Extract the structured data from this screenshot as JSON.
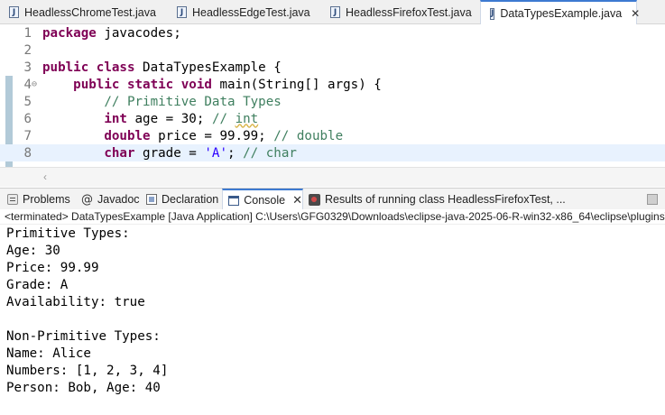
{
  "editor_tabs": [
    {
      "label": "HeadlessChromeTest.java",
      "active": false
    },
    {
      "label": "HeadlessEdgeTest.java",
      "active": false
    },
    {
      "label": "HeadlessFirefoxTest.java",
      "active": false
    },
    {
      "label": "DataTypesExample.java",
      "active": true
    }
  ],
  "editor_close_glyph": "✕",
  "file_icon_letter": "J",
  "code": {
    "line_numbers": [
      "1",
      "2",
      "3",
      "4",
      "5",
      "6",
      "7",
      "8"
    ],
    "fold_marker": "⊖",
    "l1": {
      "kw": "package",
      "rest": " javacodes;"
    },
    "l3": {
      "kw1": "public",
      "kw2": "class",
      "rest": " DataTypesExample {"
    },
    "l4": {
      "kw1": "public",
      "kw2": "static",
      "kw3": "void",
      "rest": " main(String[] args) {"
    },
    "l5": {
      "comment": "// Primitive Data Types"
    },
    "l6": {
      "kw": "int",
      "rest": " age = 30; ",
      "comment_a": "// ",
      "comment_b": "int"
    },
    "l7": {
      "kw": "double",
      "rest": " price = 99.99; ",
      "comment": "// double"
    },
    "l8": {
      "kw": "char",
      "rest": " grade = ",
      "str": "'A'",
      "rest2": "; ",
      "comment": "// char"
    }
  },
  "panel_tabs": [
    {
      "label": "Problems",
      "icon": "problems-icon"
    },
    {
      "label": "Javadoc",
      "icon": "javadoc-icon"
    },
    {
      "label": "Declaration",
      "icon": "declaration-icon"
    },
    {
      "label": "Console",
      "icon": "console-icon",
      "active": true
    },
    {
      "label": "Results of running class HeadlessFirefoxTest, ...",
      "icon": "test-results-icon"
    }
  ],
  "javadoc_glyph": "@",
  "panel_close_glyph": "✕",
  "console_status": "<terminated> DataTypesExample [Java Application] C:\\Users\\GFG0329\\Downloads\\eclipse-java-2025-06-R-win32-x86_64\\eclipse\\plugins\\o",
  "console_output": [
    "Primitive Types:",
    "Age: 30",
    "Price: 99.99",
    "Grade: A",
    "Availability: true",
    "",
    "Non-Primitive Types:",
    "Name: Alice",
    "Numbers: [1, 2, 3, 4]",
    "Person: Bob, Age: 40"
  ],
  "colors": {
    "keyword": "#7f0055",
    "comment": "#3f7f5f",
    "string": "#2a00ff",
    "active_tab_accent": "#3d7ad1"
  }
}
